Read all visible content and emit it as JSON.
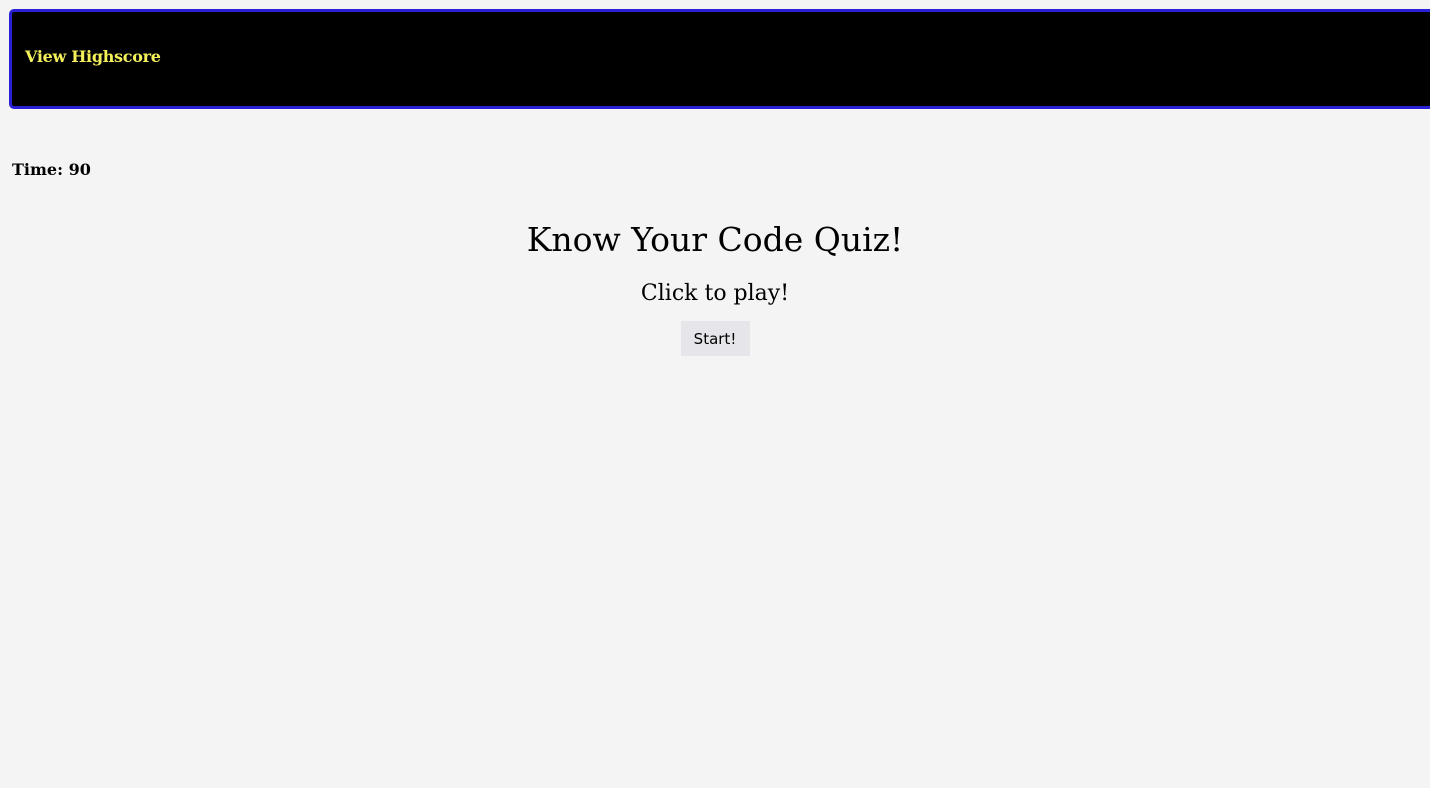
{
  "header": {
    "highscore_link": "View Highscore"
  },
  "timer": {
    "text": "Time: 90"
  },
  "main": {
    "title": "Know Your Code Quiz!",
    "subtitle": "Click to play!",
    "start_button": "Start!"
  },
  "colors": {
    "page_background": "#f4f4f4",
    "header_background": "#000000",
    "header_border": "#2a20d6",
    "link_color": "#f4f05a",
    "button_background": "#e6e6ea"
  }
}
